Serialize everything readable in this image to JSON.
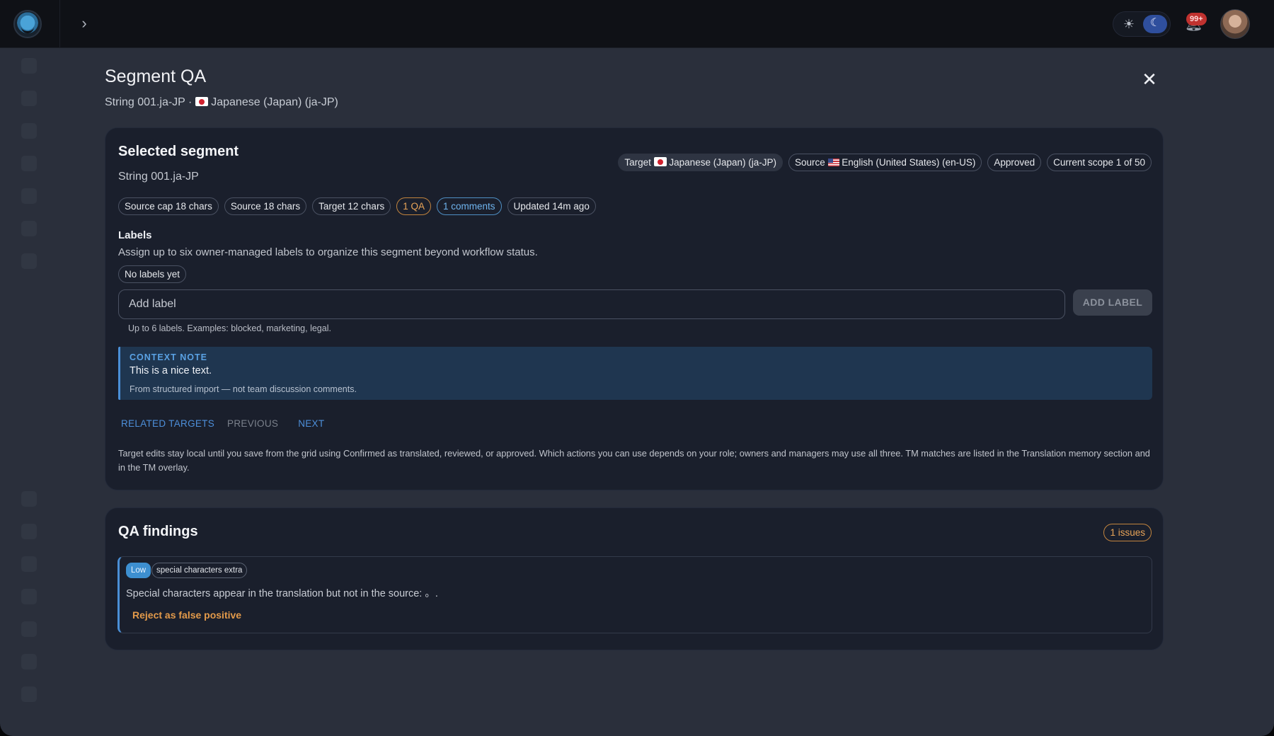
{
  "topbar": {
    "notifications_badge": "99+"
  },
  "modal": {
    "title": "Segment QA",
    "subtitle_prefix": "String 001.ja-JP ·",
    "subtitle_locale": "Japanese (Japan) (ja-JP)"
  },
  "selected": {
    "heading": "Selected segment",
    "string_id": "String 001.ja-JP",
    "header_chips": {
      "target_prefix": "Target",
      "target_locale": "Japanese (Japan) (ja-JP)",
      "source_prefix": "Source",
      "source_locale": "English (United States) (en-US)",
      "status": "Approved",
      "scope": "Current scope 1 of 50"
    },
    "meta_chips": [
      "Source cap 18 chars",
      "Source 18 chars",
      "Target 12 chars",
      "1 QA",
      "1 comments",
      "Updated 14m ago"
    ],
    "labels": {
      "heading": "Labels",
      "description": "Assign up to six owner-managed labels to organize this segment beyond workflow status.",
      "empty_chip": "No labels yet",
      "input_placeholder": "Add label",
      "add_button": "ADD LABEL",
      "hint": "Up to 6 labels. Examples: blocked, marketing, legal."
    },
    "context_note": {
      "heading": "CONTEXT NOTE",
      "text": "This is a nice text.",
      "source": "From structured import — not team discussion comments."
    },
    "nav": {
      "related": "RELATED TARGETS",
      "previous": "PREVIOUS",
      "next": "NEXT"
    },
    "footnote": "Target edits stay local until you save from the grid using Confirmed as translated, reviewed, or approved. Which actions you can use depends on your role; owners and managers may use all three. TM matches are listed in the Translation memory section and in the TM overlay."
  },
  "qa": {
    "heading": "QA findings",
    "issues_badge": "1 issues",
    "findings": [
      {
        "severity": "Low",
        "type": "special characters extra",
        "message": "Special characters appear in the translation but not in the source: 。.",
        "action": "Reject as false positive"
      }
    ]
  },
  "colors": {
    "accent_blue": "#4a8fd6",
    "warning_orange": "#e39a4a",
    "comments_blue": "#6fb4ee",
    "notification_red": "#c0322f"
  },
  "icons": [
    "logo-icon",
    "chevron-right-icon",
    "sun-icon",
    "moon-icon",
    "bell-icon",
    "close-icon"
  ]
}
